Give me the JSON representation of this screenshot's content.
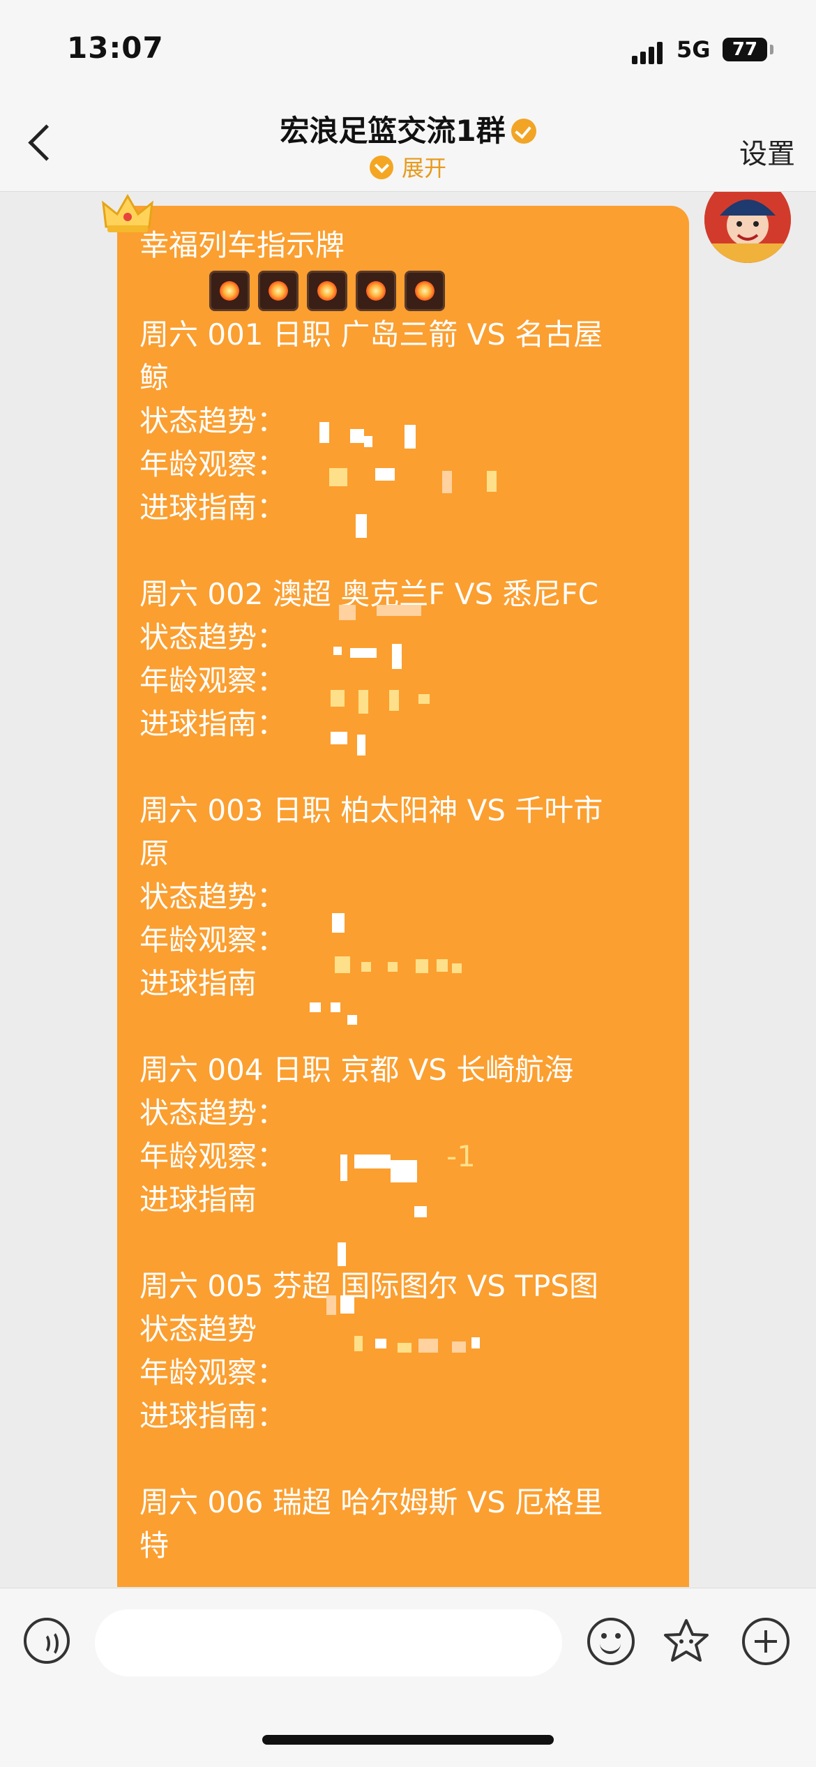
{
  "status_bar": {
    "time": "13:07",
    "network": "5G",
    "battery": "77"
  },
  "nav": {
    "title": "宏浪足篮交流1群",
    "expand_label": "展开",
    "settings_label": "设置"
  },
  "message": {
    "title": "幸福列车指示牌",
    "lines": [
      "周六 001 日职 广岛三箭 VS 名古屋",
      "鲸",
      "状态趋势：",
      "年龄观察：",
      "进球指南：",
      "",
      "周六 002 澳超 奥克兰F VS 悉尼FC",
      "状态趋势：",
      "年龄观察：",
      "进球指南：",
      "",
      "周六 003 日职 柏太阳神 VS 千叶市",
      "原",
      "状态趋势：",
      "年龄观察：",
      "进球指南",
      "",
      "周六 004 日职 京都 VS 长崎航海",
      "状态趋势：",
      "年龄观察：",
      "进球指南",
      "",
      "周六 005 芬超 国际图尔 VS TPS图",
      "状态趋势",
      "年龄观察：",
      "进球指南：",
      "",
      "周六 006 瑞超 哈尔姆斯 VS 厄格里",
      "特"
    ],
    "visible_fragment": "-1"
  },
  "input": {
    "placeholder": ""
  },
  "icons": {
    "back": "back-arrow-icon",
    "badge": "verified-badge-icon",
    "expand": "chevron-down-icon",
    "voice": "voice-icon",
    "emoji": "emoji-icon",
    "sticker": "sticker-icon",
    "plus": "plus-icon"
  },
  "colors": {
    "bubble": "#fb9f30",
    "accent": "#e79a1c",
    "background": "#ececec"
  }
}
